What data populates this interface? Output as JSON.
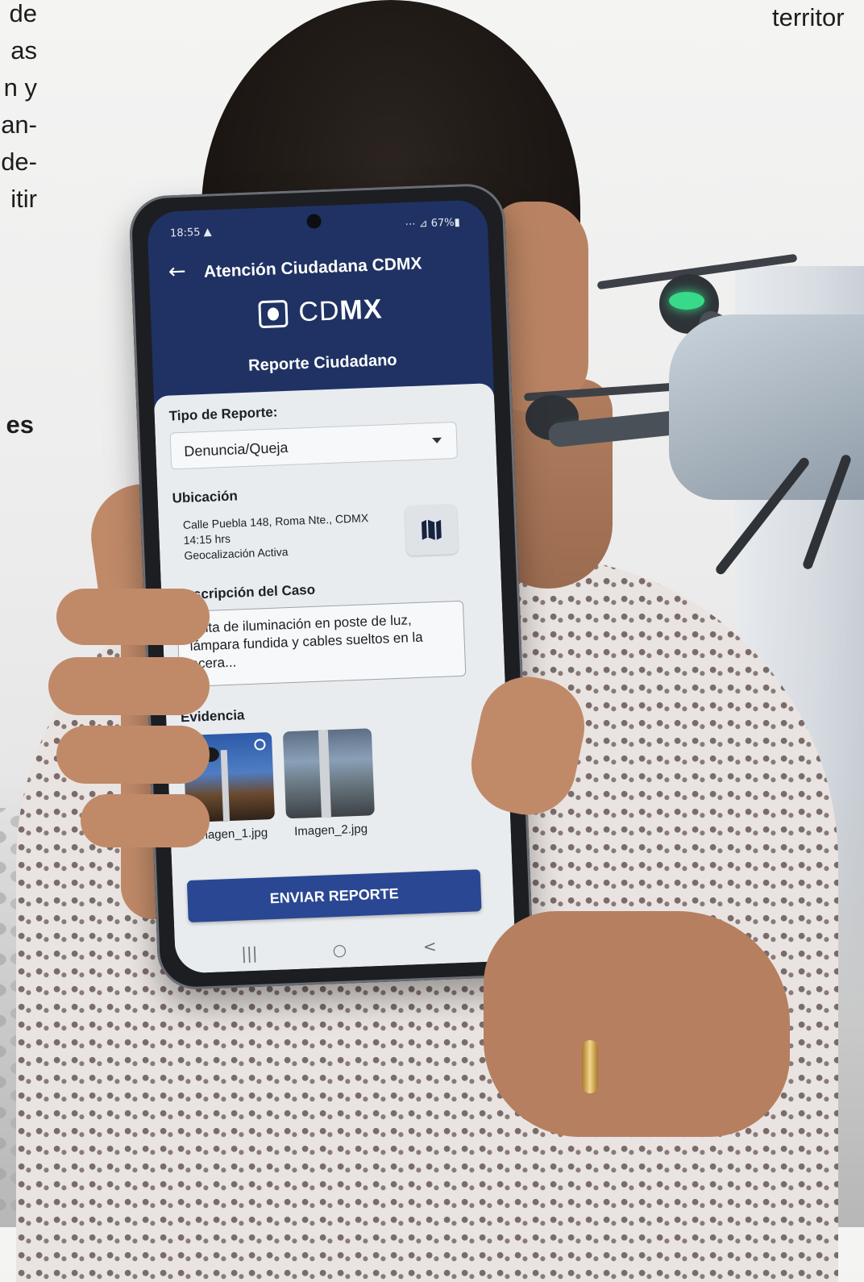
{
  "page_text": {
    "left_column_fragments": [
      "de",
      "as",
      "n y",
      "an-",
      "de-",
      "itir"
    ],
    "bold_fragment": "es",
    "top_right_fragment": "territor"
  },
  "phone": {
    "status_bar": {
      "time": "18:55 ▲",
      "indicators": "⋯ ⊿ 67%▮"
    },
    "app_bar": {
      "back_icon": "arrow-left-icon",
      "title": "Atención Ciudadana CDMX"
    },
    "logo": {
      "prefix": "CD",
      "suffix": "MX"
    },
    "subtitle": "Reporte Ciudadano",
    "form": {
      "report_type_label": "Tipo de Reporte:",
      "report_type_value": "Denuncia/Queja",
      "location_label": "Ubicación",
      "location_lines": [
        "Calle Puebla 148, Roma Nte., CDMX",
        "14:15 hrs",
        "Geocalización Activa"
      ],
      "map_icon": "map-icon",
      "description_label": "Descripción del Caso",
      "description_value": "Falta de iluminación en poste de luz, lámpara fundida y cables sueltos en la acera...",
      "evidence_label": "Evidencia",
      "evidence": [
        {
          "caption": "Imagen_1.jpg"
        },
        {
          "caption": "Imagen_2.jpg"
        }
      ],
      "submit_label": "ENVIAR REPORTE"
    },
    "nav_bar": {
      "recents": "|||",
      "home": "○",
      "back": "<"
    }
  },
  "colors": {
    "app_header": "#1f3263",
    "form_background": "#e9ecef",
    "submit_button": "#2a4793",
    "drone_led_green": "#39d98a",
    "drone_led_red": "#ff3b30"
  }
}
